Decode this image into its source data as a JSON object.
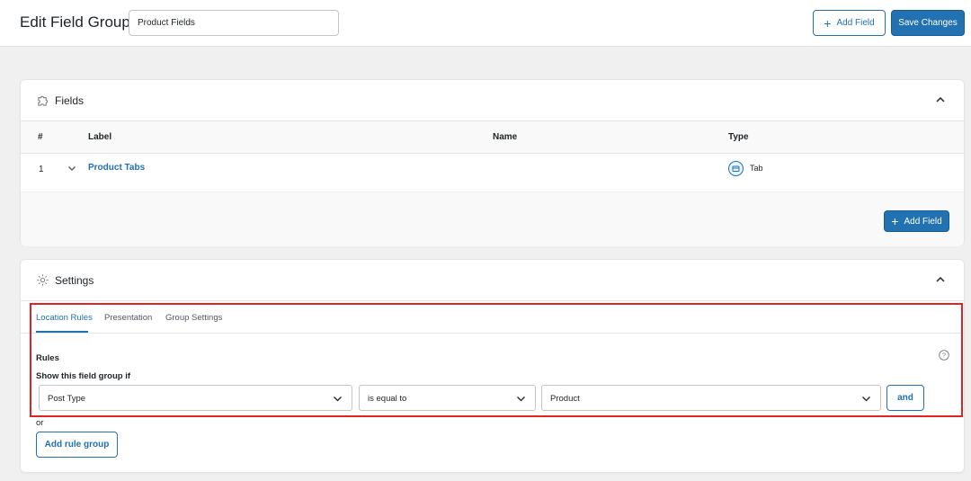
{
  "header": {
    "title": "Edit Field Group",
    "group_name": "Product Fields",
    "add_field_label": "Add Field",
    "save_label": "Save Changes"
  },
  "fields_panel": {
    "title": "Fields",
    "columns": [
      "#",
      "Label",
      "Name",
      "Type"
    ],
    "rows": [
      {
        "index": "1",
        "label": "Product Tabs",
        "name": "",
        "type": "Tab"
      }
    ],
    "add_field_label": "Add Field"
  },
  "settings_panel": {
    "title": "Settings",
    "tabs": [
      "Location Rules",
      "Presentation",
      "Group Settings"
    ],
    "active_tab": "Location Rules",
    "rules_label": "Rules",
    "show_if_label": "Show this field group if",
    "rule": {
      "param": "Post Type",
      "operator": "is equal to",
      "value": "Product"
    },
    "and_label": "and",
    "or_label": "or",
    "add_rule_group_label": "Add rule group"
  },
  "colors": {
    "accent": "#2271b1",
    "highlight": "#e02424",
    "background": "#f0f0f1"
  }
}
